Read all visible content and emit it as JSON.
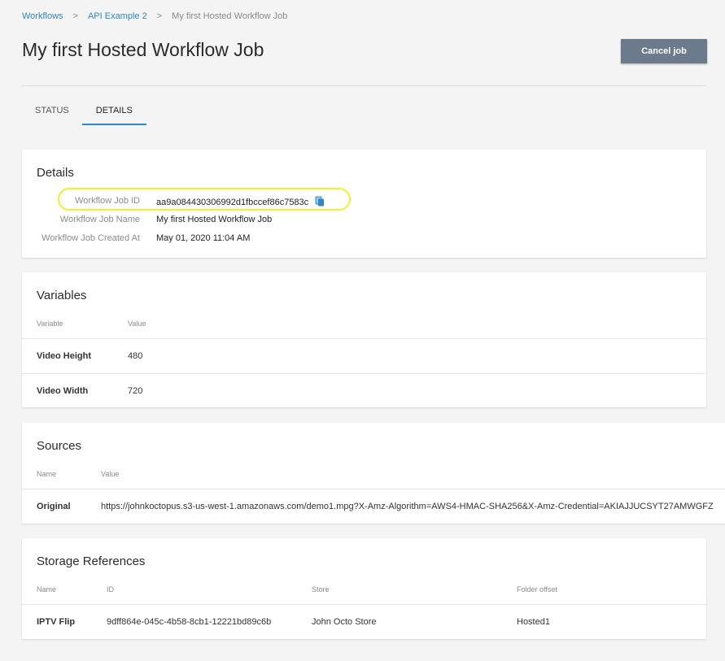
{
  "breadcrumb": {
    "items": [
      "Workflows",
      "API Example 2"
    ],
    "separator": ">",
    "current": "My first Hosted Workflow Job"
  },
  "page": {
    "title": "My first Hosted Workflow Job",
    "cancel_label": "Cancel job"
  },
  "tabs": [
    {
      "label": "STATUS",
      "active": false
    },
    {
      "label": "DETAILS",
      "active": true
    }
  ],
  "details": {
    "title": "Details",
    "rows": [
      {
        "label": "Workflow Job ID",
        "value": "aa9a084430306992d1fbccef86c7583c"
      },
      {
        "label": "Workflow Job Name",
        "value": "My first Hosted Workflow Job"
      },
      {
        "label": "Workflow Job Created At",
        "value": "May 01, 2020 11:04 AM"
      }
    ],
    "copy_icon": "copy-icon"
  },
  "variables": {
    "title": "Variables",
    "headers": [
      "Variable",
      "Value"
    ],
    "rows": [
      {
        "name": "Video Height",
        "value": "480"
      },
      {
        "name": "Video Width",
        "value": "720"
      }
    ]
  },
  "sources": {
    "title": "Sources",
    "headers": [
      "Name",
      "Value"
    ],
    "rows": [
      {
        "name": "Original",
        "value": "https://johnkoctopus.s3-us-west-1.amazonaws.com/demo1.mpg?X-Amz-Algorithm=AWS4-HMAC-SHA256&X-Amz-Credential=AKIAJJUCSYT27AMWGFZ"
      }
    ]
  },
  "storage": {
    "title": "Storage References",
    "headers": [
      "Name",
      "ID",
      "Store",
      "Folder offset"
    ],
    "rows": [
      {
        "name": "IPTV Flip",
        "id": "9dff864e-045c-4b58-8cb1-12221bd89c6b",
        "store": "John Octo Store",
        "folder": "Hosted1"
      }
    ]
  },
  "colors": {
    "link": "#2f86c9",
    "button": "#6c7b8b",
    "highlight": "#f2ef2a",
    "background": "#f4f4f4"
  }
}
